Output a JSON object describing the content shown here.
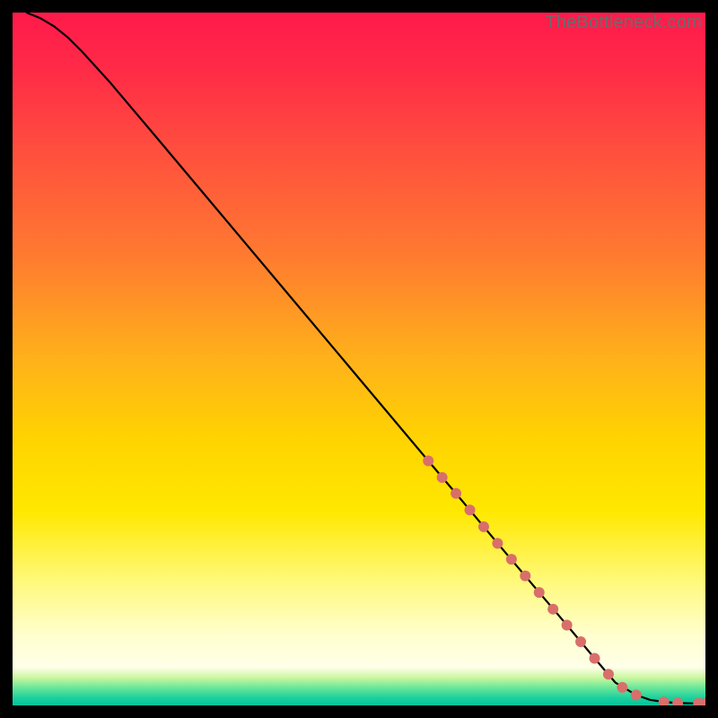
{
  "watermark": "TheBottleneck.com",
  "chart_data": {
    "type": "line",
    "title": "",
    "xlabel": "",
    "ylabel": "",
    "xlim": [
      0,
      100
    ],
    "ylim": [
      0,
      100
    ],
    "grid": false,
    "legend": false,
    "background_gradient_stops": [
      {
        "offset": 0.0,
        "color": "#ff1a4b"
      },
      {
        "offset": 0.08,
        "color": "#ff2a47"
      },
      {
        "offset": 0.2,
        "color": "#ff4f3e"
      },
      {
        "offset": 0.35,
        "color": "#ff7a30"
      },
      {
        "offset": 0.5,
        "color": "#ffb11a"
      },
      {
        "offset": 0.62,
        "color": "#ffd400"
      },
      {
        "offset": 0.72,
        "color": "#ffe800"
      },
      {
        "offset": 0.82,
        "color": "#fff97a"
      },
      {
        "offset": 0.9,
        "color": "#ffffd0"
      },
      {
        "offset": 0.945,
        "color": "#ffffe8"
      },
      {
        "offset": 0.96,
        "color": "#caf7a0"
      },
      {
        "offset": 0.975,
        "color": "#66e69a"
      },
      {
        "offset": 0.99,
        "color": "#18cf9e"
      },
      {
        "offset": 1.0,
        "color": "#05c39b"
      }
    ],
    "series": [
      {
        "name": "curve",
        "style": "line",
        "color": "#000000",
        "x": [
          2,
          4,
          6,
          8,
          10,
          14,
          20,
          30,
          40,
          50,
          60,
          65,
          70,
          75,
          80,
          84,
          87,
          90,
          92,
          94,
          96,
          98,
          100
        ],
        "y": [
          100,
          99.2,
          98.0,
          96.4,
          94.4,
          90.0,
          82.9,
          71.0,
          59.1,
          47.2,
          35.3,
          29.4,
          23.4,
          17.5,
          11.6,
          6.8,
          3.3,
          1.5,
          0.8,
          0.5,
          0.35,
          0.3,
          0.3
        ]
      },
      {
        "name": "dots",
        "style": "scatter",
        "color": "#d86f6a",
        "radius": 6,
        "x": [
          60,
          62,
          64,
          66,
          68,
          70,
          72,
          74,
          76,
          78,
          80,
          82,
          84,
          86,
          88,
          90,
          94,
          96,
          99,
          100
        ],
        "y": [
          35.3,
          32.9,
          30.6,
          28.2,
          25.8,
          23.4,
          21.1,
          18.7,
          16.3,
          13.9,
          11.6,
          9.2,
          6.8,
          4.5,
          2.6,
          1.5,
          0.5,
          0.35,
          0.3,
          0.3
        ]
      }
    ]
  }
}
